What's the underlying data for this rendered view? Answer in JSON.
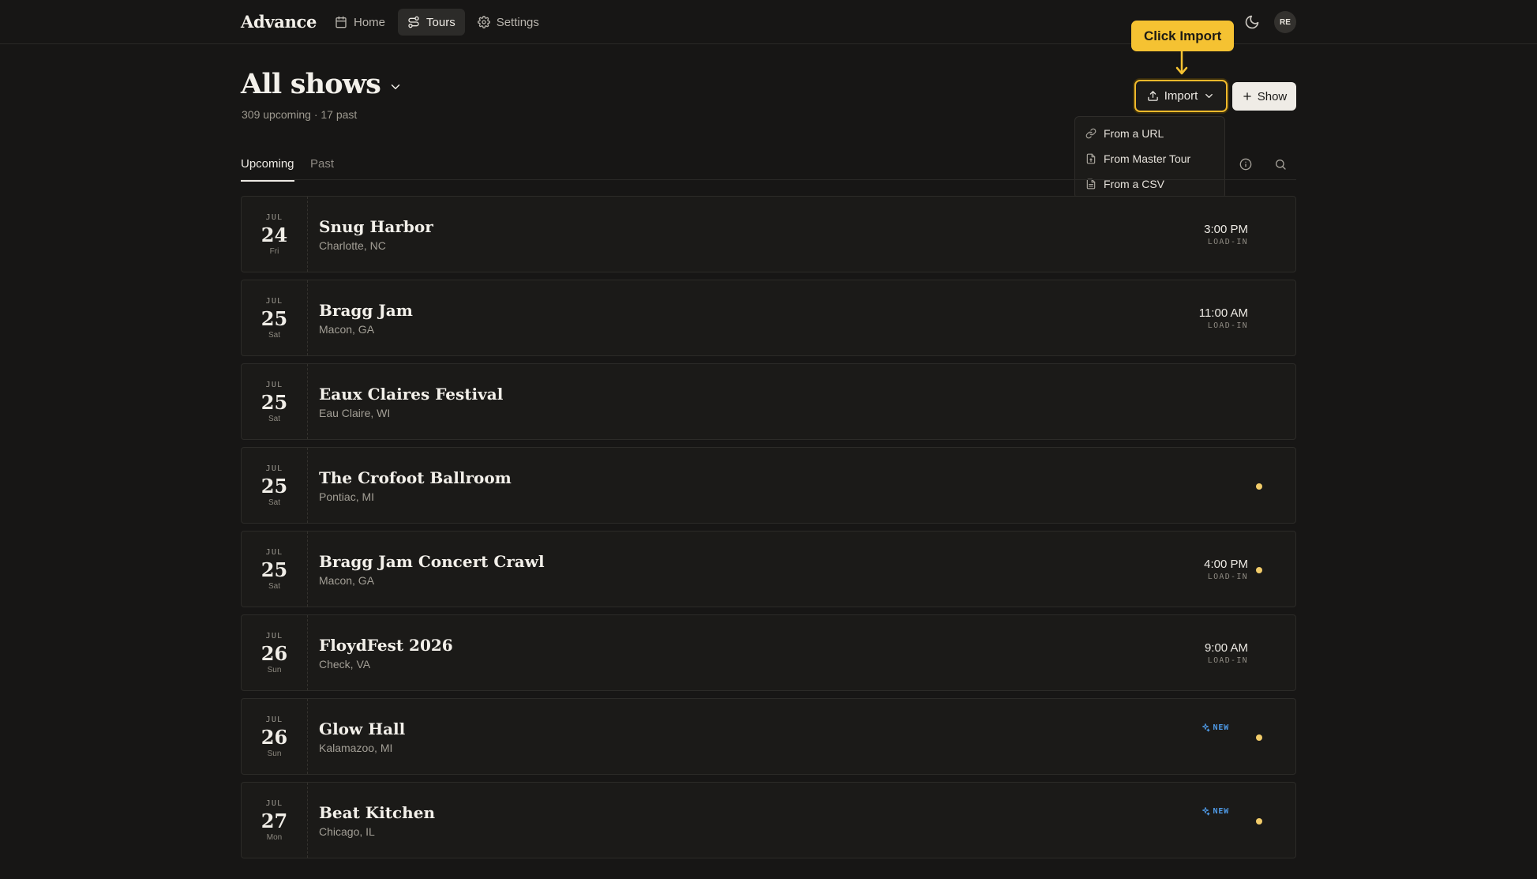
{
  "app": {
    "brand": "Advance",
    "avatar_initials": "RE"
  },
  "nav": [
    {
      "label": "Home",
      "icon": "calendar-icon",
      "active": false
    },
    {
      "label": "Tours",
      "icon": "route-icon",
      "active": true
    },
    {
      "label": "Settings",
      "icon": "gear-icon",
      "active": false
    }
  ],
  "header": {
    "title": "All shows",
    "subtitle": "309 upcoming · 17 past"
  },
  "callout": {
    "text": "Click Import",
    "color": "#f5c232"
  },
  "actions": {
    "import_label": "Import",
    "show_label": "Show"
  },
  "import_menu": [
    {
      "label": "From a URL",
      "icon": "link-icon"
    },
    {
      "label": "From Master Tour",
      "icon": "file-import-icon"
    },
    {
      "label": "From a CSV",
      "icon": "file-spreadsheet-icon"
    }
  ],
  "tabs": [
    {
      "label": "Upcoming",
      "active": true
    },
    {
      "label": "Past",
      "active": false
    }
  ],
  "shows": [
    {
      "month": "JUL",
      "day": "24",
      "dow": "Fri",
      "venue": "Snug Harbor",
      "city": "Charlotte, NC",
      "time": "3:00 PM",
      "time_label": "LOAD-IN",
      "is_new": false,
      "new_label": "",
      "dot": false
    },
    {
      "month": "JUL",
      "day": "25",
      "dow": "Sat",
      "venue": "Bragg Jam",
      "city": "Macon, GA",
      "time": "11:00 AM",
      "time_label": "LOAD-IN",
      "is_new": false,
      "new_label": "",
      "dot": false
    },
    {
      "month": "JUL",
      "day": "25",
      "dow": "Sat",
      "venue": "Eaux Claires Festival",
      "city": "Eau Claire, WI",
      "time": "",
      "time_label": "",
      "is_new": false,
      "new_label": "",
      "dot": false
    },
    {
      "month": "JUL",
      "day": "25",
      "dow": "Sat",
      "venue": "The Crofoot Ballroom",
      "city": "Pontiac, MI",
      "time": "",
      "time_label": "",
      "is_new": false,
      "new_label": "",
      "dot": true
    },
    {
      "month": "JUL",
      "day": "25",
      "dow": "Sat",
      "venue": "Bragg Jam Concert Crawl",
      "city": "Macon, GA",
      "time": "4:00 PM",
      "time_label": "LOAD-IN",
      "is_new": false,
      "new_label": "",
      "dot": true
    },
    {
      "month": "JUL",
      "day": "26",
      "dow": "Sun",
      "venue": "FloydFest 2026",
      "city": "Check, VA",
      "time": "9:00 AM",
      "time_label": "LOAD-IN",
      "is_new": false,
      "new_label": "",
      "dot": false
    },
    {
      "month": "JUL",
      "day": "26",
      "dow": "Sun",
      "venue": "Glow Hall",
      "city": "Kalamazoo, MI",
      "time": "",
      "time_label": "",
      "is_new": true,
      "new_label": "NEW",
      "dot": true
    },
    {
      "month": "JUL",
      "day": "27",
      "dow": "Mon",
      "venue": "Beat Kitchen",
      "city": "Chicago, IL",
      "time": "",
      "time_label": "",
      "is_new": true,
      "new_label": "NEW",
      "dot": true
    }
  ]
}
